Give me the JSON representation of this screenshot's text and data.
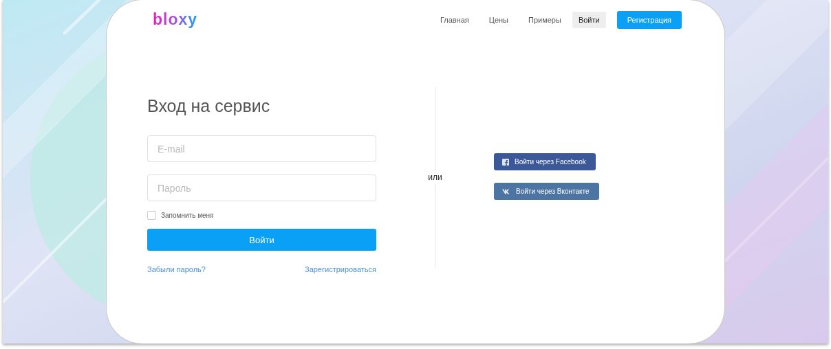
{
  "logo": "bloxy",
  "nav": [
    {
      "label": "Главная",
      "selected": false
    },
    {
      "label": "Цены",
      "selected": false
    },
    {
      "label": "Примеры",
      "selected": false
    },
    {
      "label": "Войти",
      "selected": true
    }
  ],
  "register_button": "Регистрация",
  "login": {
    "title": "Вход на сервис",
    "email": {
      "placeholder": "E-mail"
    },
    "password": {
      "placeholder": "Пароль"
    },
    "remember": {
      "label": "Запомнить меня",
      "checked": false
    },
    "submit": "Войти",
    "forgot": "Забыли пароль?",
    "register": "Зарегистрироваться"
  },
  "separator": "или",
  "social": [
    {
      "label": "Войти через Facebook",
      "kind": "facebook"
    },
    {
      "label": "Войти через Вконтакте",
      "kind": "vk"
    }
  ]
}
